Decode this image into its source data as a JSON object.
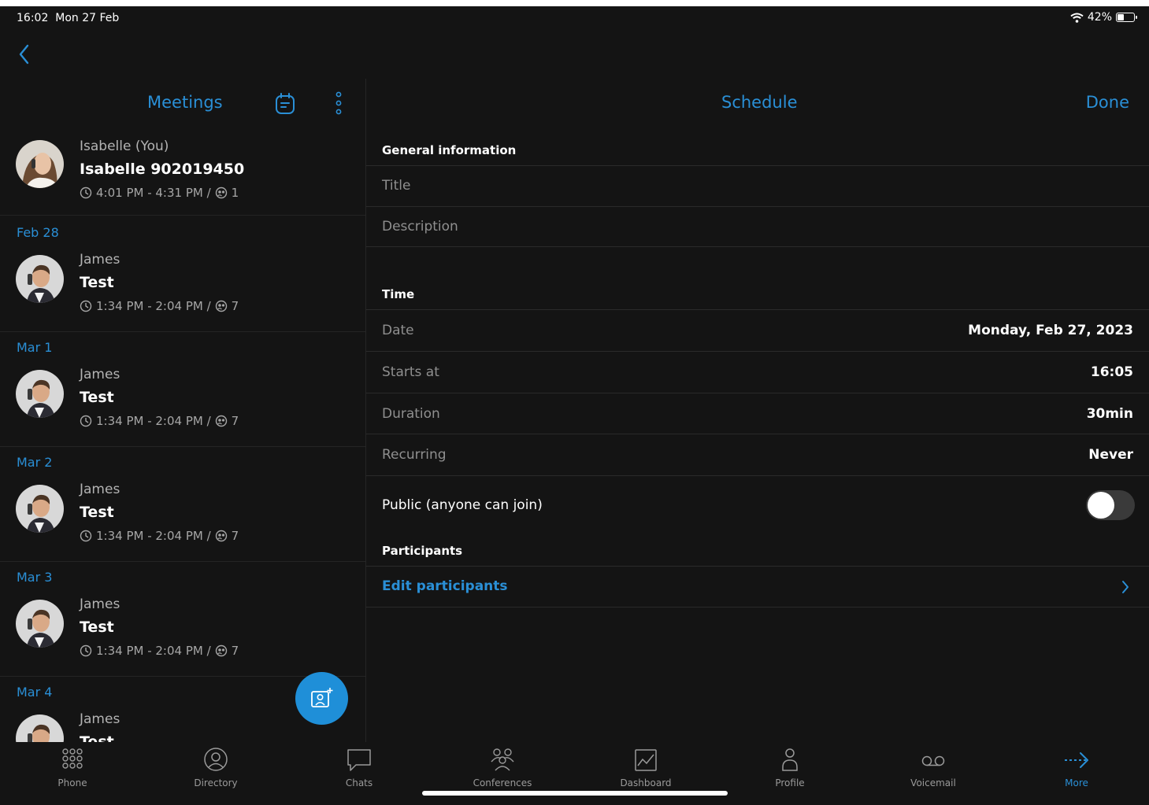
{
  "status_bar": {
    "time": "16:02",
    "date": "Mon 27 Feb",
    "battery": "42%",
    "battery_level": 0.42
  },
  "meetings_pane": {
    "title": "Meetings",
    "own_meeting": {
      "name": "Isabelle (You)",
      "subject": "Isabelle 902019450",
      "time": "4:01 PM - 4:31 PM /",
      "participants": "1"
    },
    "groups": [
      {
        "date": "Feb 28",
        "name": "James",
        "subject": "Test",
        "time": "1:34 PM - 2:04 PM /",
        "participants": "7"
      },
      {
        "date": "Mar 1",
        "name": "James",
        "subject": "Test",
        "time": "1:34 PM - 2:04 PM /",
        "participants": "7"
      },
      {
        "date": "Mar 2",
        "name": "James",
        "subject": "Test",
        "time": "1:34 PM - 2:04 PM /",
        "participants": "7"
      },
      {
        "date": "Mar 3",
        "name": "James",
        "subject": "Test",
        "time": "1:34 PM - 2:04 PM /",
        "participants": "7"
      },
      {
        "date": "Mar 4",
        "name": "James",
        "subject": "Test",
        "time": "",
        "participants": ""
      }
    ]
  },
  "schedule": {
    "title": "Schedule",
    "done": "Done",
    "general_information": "General information",
    "title_placeholder": "Title",
    "description_placeholder": "Description",
    "time_section": "Time",
    "date_label": "Date",
    "date_value": "Monday, Feb 27, 2023",
    "starts_label": "Starts at",
    "starts_value": "16:05",
    "duration_label": "Duration",
    "duration_value": "30min",
    "recurring_label": "Recurring",
    "recurring_value": "Never",
    "public_label": "Public (anyone can join)",
    "public_on": false,
    "participants_section": "Participants",
    "edit_participants": "Edit participants"
  },
  "tabbar": {
    "items": [
      {
        "label": "Phone",
        "icon": "dialpad-icon"
      },
      {
        "label": "Directory",
        "icon": "user-circle-icon"
      },
      {
        "label": "Chats",
        "icon": "chat-bubble-icon"
      },
      {
        "label": "Conferences",
        "icon": "group-icon"
      },
      {
        "label": "Dashboard",
        "icon": "chart-icon"
      },
      {
        "label": "Profile",
        "icon": "person-icon"
      },
      {
        "label": "Voicemail",
        "icon": "voicemail-icon"
      },
      {
        "label": "More",
        "icon": "arrow-right-icon"
      }
    ],
    "active": "More"
  },
  "colors": {
    "accent": "#2a8fd6",
    "background": "#141414",
    "fab": "#1f8fd8"
  }
}
